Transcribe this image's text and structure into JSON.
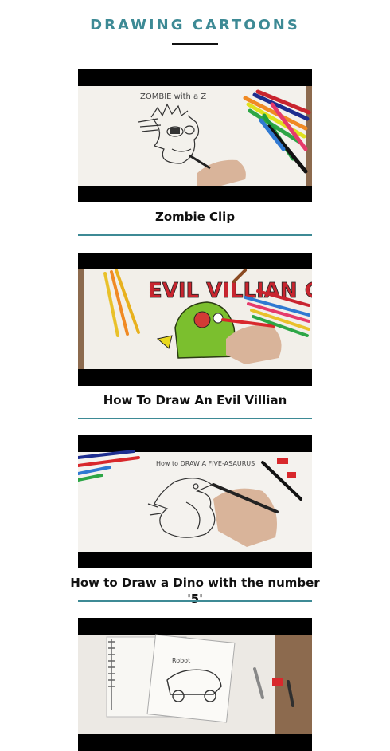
{
  "page": {
    "title": "DRAWING CARTOONS",
    "accent_color": "#3d8a95"
  },
  "videos": [
    {
      "title": "Zombie Clip",
      "thumbnail_text": "ZOMBIE with a Z"
    },
    {
      "title": "How To Draw An Evil Villian",
      "thumbnail_text": "EVIL VILLIAN CARTOONS"
    },
    {
      "title": "How to Draw a Dino with the number '5'",
      "thumbnail_text": "How to DRAW A FIVE-ASAURUS"
    },
    {
      "title": "",
      "thumbnail_text": "Robot"
    }
  ]
}
